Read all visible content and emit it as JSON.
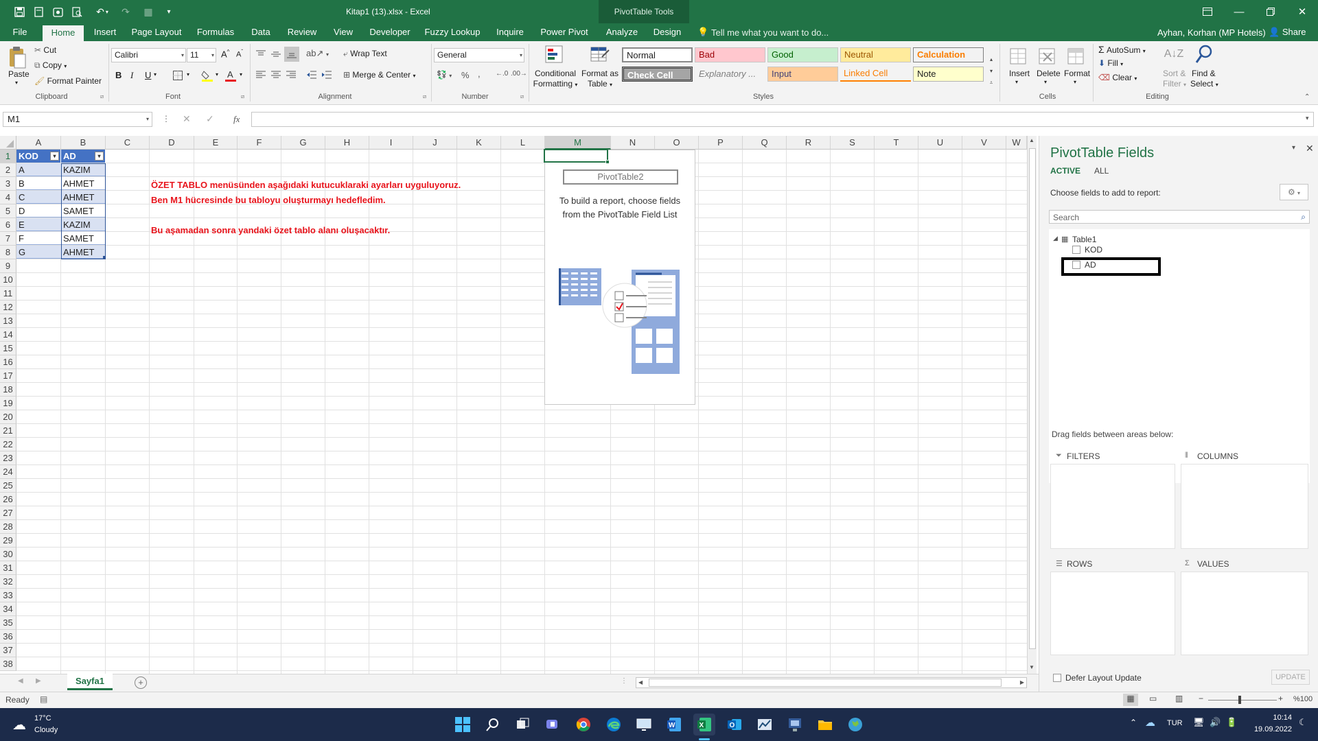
{
  "window": {
    "title": "Kitap1 (13).xlsx - Excel",
    "context_tools": "PivotTable Tools",
    "user": "Ayhan, Korhan (MP Hotels)",
    "share": "Share",
    "tell_me": "Tell me what you want to do..."
  },
  "tabs": [
    "File",
    "Home",
    "Insert",
    "Page Layout",
    "Formulas",
    "Data",
    "Review",
    "View",
    "Developer",
    "Fuzzy Lookup",
    "Inquire",
    "Power Pivot",
    "Analyze",
    "Design"
  ],
  "ribbon": {
    "clipboard": {
      "paste": "Paste",
      "cut": "Cut",
      "copy": "Copy",
      "format_painter": "Format Painter",
      "label": "Clipboard"
    },
    "font": {
      "name": "Calibri",
      "size": "11",
      "label": "Font",
      "bold": "B",
      "italic": "I",
      "underline": "U"
    },
    "alignment": {
      "wrap": "Wrap Text",
      "merge": "Merge & Center",
      "label": "Alignment"
    },
    "number": {
      "format": "General",
      "label": "Number"
    },
    "styles": {
      "conditional": "Conditional\nFormatting",
      "conditional_l1": "Conditional",
      "conditional_l2": "Formatting",
      "format_table_l1": "Format as",
      "format_table_l2": "Table",
      "cells": [
        "Normal",
        "Bad",
        "Good",
        "Neutral",
        "Calculation",
        "Check Cell",
        "Explanatory ...",
        "Input",
        "Linked Cell",
        "Note"
      ],
      "label": "Styles"
    },
    "cells": {
      "insert": "Insert",
      "delete": "Delete",
      "format": "Format",
      "label": "Cells"
    },
    "editing": {
      "autosum": "AutoSum",
      "fill": "Fill",
      "clear": "Clear",
      "sort_l1": "Sort &",
      "sort_l2": "Filter",
      "find_l1": "Find &",
      "find_l2": "Select",
      "label": "Editing"
    }
  },
  "formula_bar": {
    "name_box": "M1",
    "fx": "fx",
    "formula": ""
  },
  "columns": [
    "A",
    "B",
    "C",
    "D",
    "E",
    "F",
    "G",
    "H",
    "I",
    "J",
    "K",
    "L",
    "M",
    "N",
    "O",
    "P",
    "Q",
    "R",
    "S",
    "T",
    "U",
    "V",
    "W"
  ],
  "rows": [
    "1",
    "2",
    "3",
    "4",
    "5",
    "6",
    "7",
    "8",
    "9",
    "10",
    "11",
    "12",
    "13",
    "14",
    "15",
    "16",
    "17",
    "18",
    "19",
    "20",
    "21",
    "22",
    "23",
    "24",
    "25",
    "26",
    "27",
    "28",
    "29",
    "30",
    "31",
    "32",
    "33",
    "34",
    "35",
    "36",
    "37",
    "38"
  ],
  "table": {
    "headers": [
      "KOD",
      "AD"
    ],
    "rows": [
      [
        "A",
        "KAZIM"
      ],
      [
        "B",
        "AHMET"
      ],
      [
        "C",
        "AHMET"
      ],
      [
        "D",
        "SAMET"
      ],
      [
        "E",
        "KAZIM"
      ],
      [
        "F",
        "SAMET"
      ],
      [
        "G",
        "AHMET"
      ]
    ]
  },
  "notes": [
    "ÖZET TABLO menüsünden aşağıdaki kutucuklaraki ayarları uyguluyoruz.",
    "Ben M1 hücresinde bu tabloyu oluşturmayı hedefledim.",
    "Bu aşamadan sonra yandaki özet tablo alanı oluşacaktır."
  ],
  "pivot_placeholder": {
    "name": "PivotTable2",
    "line1": "To build a report, choose fields",
    "line2": "from the PivotTable Field List"
  },
  "pivot_pane": {
    "title": "PivotTable Fields",
    "tab_active": "ACTIVE",
    "tab_all": "ALL",
    "choose": "Choose fields to add to report:",
    "search_placeholder": "Search",
    "table_name": "Table1",
    "fields": [
      "KOD",
      "AD"
    ],
    "drag_hint": "Drag fields between areas below:",
    "filters": "FILTERS",
    "columns": "COLUMNS",
    "rows": "ROWS",
    "values": "VALUES",
    "defer": "Defer Layout Update",
    "update": "UPDATE"
  },
  "sheet_tab": "Sayfa1",
  "status": {
    "ready": "Ready",
    "zoom": "%100"
  },
  "taskbar": {
    "temp": "17°C",
    "weather": "Cloudy",
    "lang": "TUR",
    "time": "10:14",
    "date": "19.09.2022"
  },
  "colors": {
    "excel_green": "#217346",
    "note_red": "#e8141c",
    "table_header": "#4472c4",
    "table_band": "#d9e1f2"
  }
}
